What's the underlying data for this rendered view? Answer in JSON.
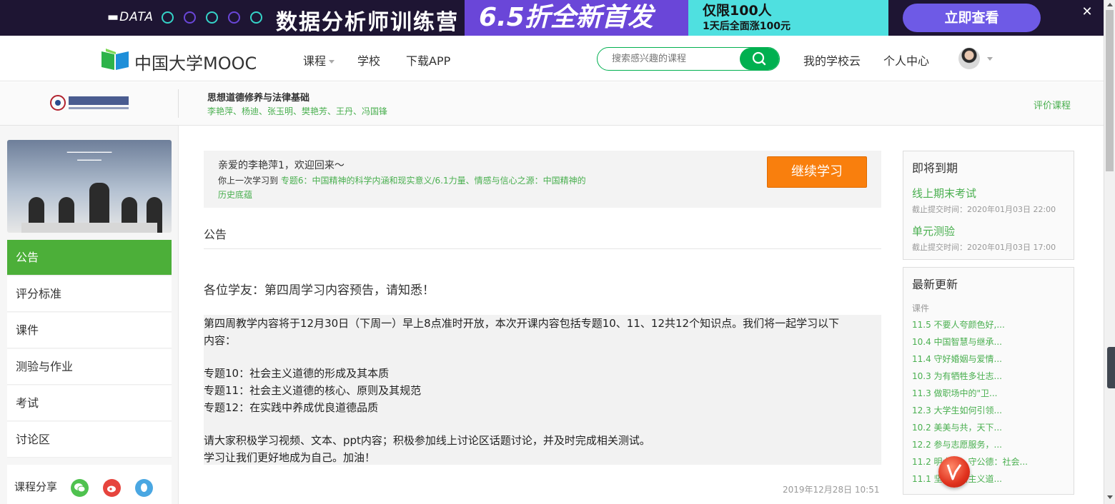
{
  "banner": {
    "data_label": "DATA",
    "title": "数据分析师训练营",
    "promo": "6.5折全新首发",
    "limited_line1": "仅限100人",
    "limited_line2": "1天后全面涨100元",
    "cta": "立即查看",
    "close": "✕"
  },
  "header": {
    "logo_text": "中国大学MOOC",
    "nav": [
      "课程",
      "学校",
      "下载APP"
    ],
    "search_placeholder": "搜索感兴趣的课程",
    "school_cloud": "我的学校云",
    "personal_center": "个人中心"
  },
  "course": {
    "title": "思想道德修养与法律基础",
    "teachers": "李艳萍、杨迪、张玉明、樊艳芳、王丹、冯国锋",
    "rate_label": "评价课程"
  },
  "sidebar": {
    "menu": [
      "公告",
      "评分标准",
      "课件",
      "测验与作业",
      "考试",
      "讨论区"
    ],
    "share_label": "课程分享"
  },
  "welcome": {
    "greeting": "亲爱的李艳萍1，欢迎回来～",
    "last_prefix": "你上一次学习到",
    "last_lesson": "专题6：中国精神的科学内涵和现实意义/6.1力量、情感与信心之源：中国精神的历史底蕴",
    "continue_label": "继续学习"
  },
  "announcement": {
    "section_title": "公告",
    "heading": "各位学友：第四周学习内容预告，请知悉！",
    "lines": [
      "第四周教学内容将于12月30日（下周一）早上8点准时开放，本次开课内容包括专题10、11、12共12个知识点。我们将一起学习以下",
      "内容：",
      "",
      "专题10：社会主义道德的形成及其本质",
      "专题11：社会主义道德的核心、原则及其规范",
      "专题12：在实践中养成优良道德品质",
      "",
      "请大家积极学习视频、文本、ppt内容；积极参加线上讨论区话题讨论，并及时完成相关测试。",
      "学习让我们更好地成为自己。加油！"
    ],
    "date": "2019年12月28日 10:51"
  },
  "due": {
    "title": "即将到期",
    "items": [
      {
        "name": "线上期末考试",
        "time": "截止提交时间：2020年01月03日 22:00"
      },
      {
        "name": "单元测验",
        "time": "截止提交时间：2020年01月03日 17:00"
      }
    ]
  },
  "updates": {
    "title": "最新更新",
    "category": "课件",
    "items": [
      "11.5 不要人夸颜色好,...",
      "10.4 中国智慧与继承...",
      "11.4 守好婚姻与爱情...",
      "10.3 为有牺牲多壮志...",
      "11.3 做职场中的\"卫...",
      "12.3 大学生如何引领...",
      "10.2 美美与共，天下...",
      "12.2 参与志愿服务，...",
      "11.2 明大德，守公德：社会...",
      "11.1 坚持社会主义道..."
    ]
  },
  "colors": {
    "brand_green": "#49af4f",
    "active_menu": "#4caf39",
    "continue_orange": "#f97f0d",
    "banner_bg": "#1e1533"
  }
}
